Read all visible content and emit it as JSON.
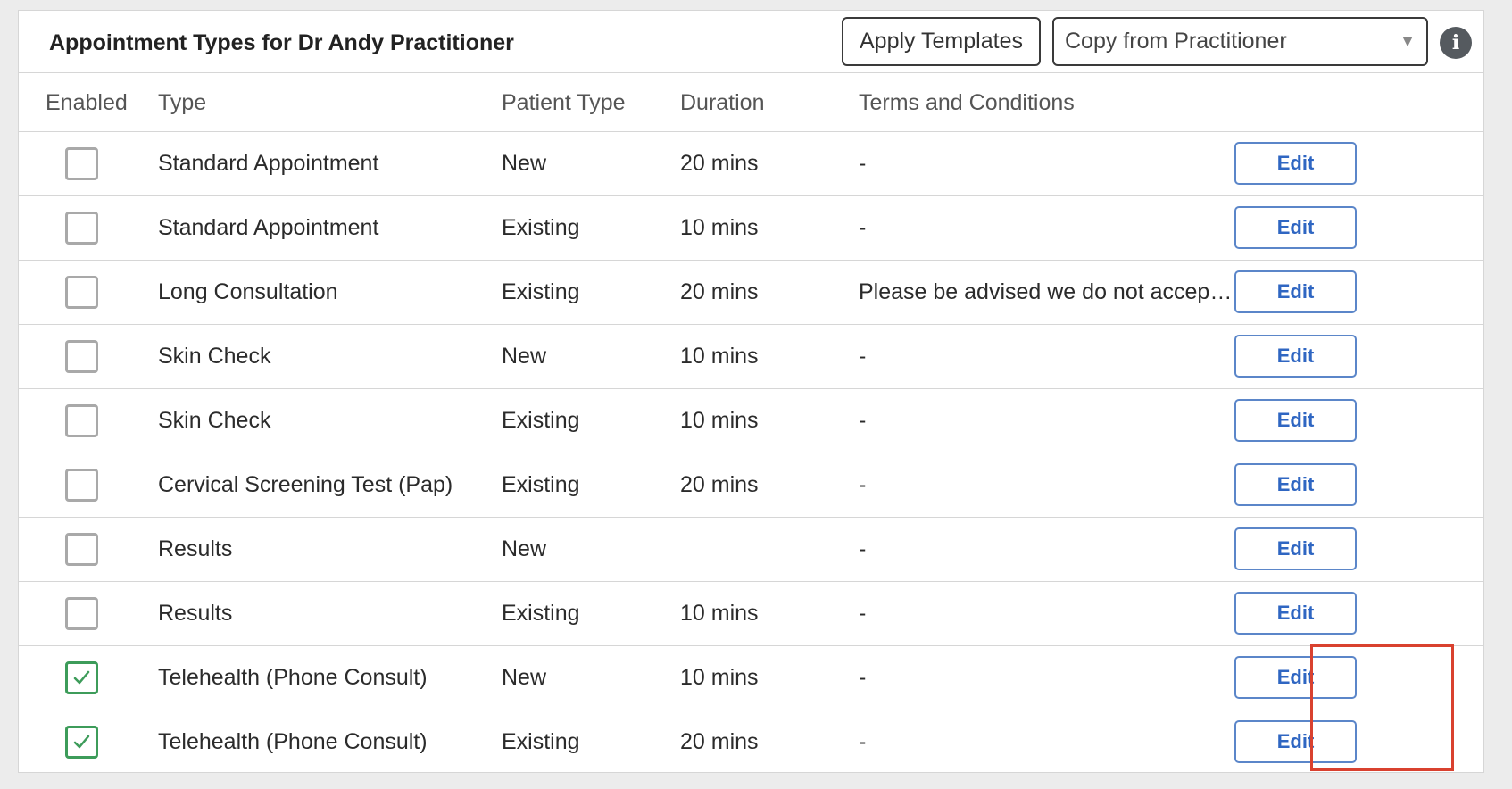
{
  "header": {
    "title": "Appointment Types for Dr Andy Practitioner",
    "apply_templates_label": "Apply Templates",
    "copy_select": {
      "selected": "Copy from Practitioner",
      "caret": "▼"
    },
    "info_icon": "i"
  },
  "columns": {
    "enabled": "Enabled",
    "type": "Type",
    "patient_type": "Patient Type",
    "duration": "Duration",
    "terms": "Terms and Conditions"
  },
  "rows": [
    {
      "enabled": false,
      "type": "Standard Appointment",
      "patient_type": "New",
      "duration": "20 mins",
      "terms": "-",
      "action": "Edit"
    },
    {
      "enabled": false,
      "type": "Standard Appointment",
      "patient_type": "Existing",
      "duration": "10 mins",
      "terms": "-",
      "action": "Edit"
    },
    {
      "enabled": false,
      "type": "Long Consultation",
      "patient_type": "Existing",
      "duration": "20 mins",
      "terms": "Please be advised we do not accep…",
      "action": "Edit"
    },
    {
      "enabled": false,
      "type": "Skin Check",
      "patient_type": "New",
      "duration": "10 mins",
      "terms": "-",
      "action": "Edit"
    },
    {
      "enabled": false,
      "type": "Skin Check",
      "patient_type": "Existing",
      "duration": "10 mins",
      "terms": "-",
      "action": "Edit"
    },
    {
      "enabled": false,
      "type": "Cervical Screening Test (Pap)",
      "patient_type": "Existing",
      "duration": "20 mins",
      "terms": "-",
      "action": "Edit"
    },
    {
      "enabled": false,
      "type": "Results",
      "patient_type": "New",
      "duration": "",
      "terms": "-",
      "action": "Edit"
    },
    {
      "enabled": false,
      "type": "Results",
      "patient_type": "Existing",
      "duration": "10 mins",
      "terms": "-",
      "action": "Edit"
    },
    {
      "enabled": true,
      "type": "Telehealth (Phone Consult)",
      "patient_type": "New",
      "duration": "10 mins",
      "terms": "-",
      "action": "Edit"
    },
    {
      "enabled": true,
      "type": "Telehealth (Phone Consult)",
      "patient_type": "Existing",
      "duration": "20 mins",
      "terms": "-",
      "action": "Edit"
    }
  ],
  "colors": {
    "edit_button": "#2f66c2",
    "checked_border": "#3d9c5a",
    "highlight": "#d9412f"
  }
}
